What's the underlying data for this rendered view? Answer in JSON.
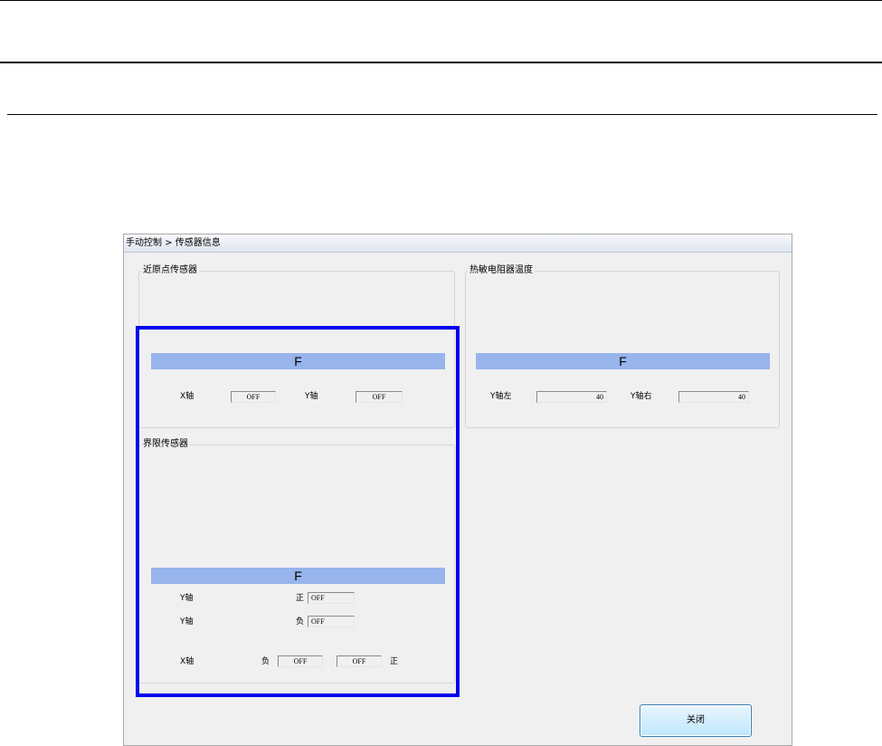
{
  "title": "手动控制 > 传感器信息",
  "near_origin": {
    "group_label": "近原点传感器",
    "bar_text": "F",
    "x_label": "X轴",
    "x_value": "OFF",
    "y_label": "Y轴",
    "y_value": "OFF"
  },
  "thermistor": {
    "group_label": "热敏电阻器温度",
    "bar_text": "F",
    "left_label": "Y轴左",
    "left_value": "40",
    "right_label": "Y轴右",
    "right_value": "40"
  },
  "limit": {
    "group_label": "界限传感器",
    "bar_text": "F",
    "row1_axis": "Y轴",
    "row1_dir": "正",
    "row1_value": "OFF",
    "row2_axis": "Y轴",
    "row2_dir": "负",
    "row2_value": "OFF",
    "row3_axis": "X轴",
    "row3_neg": "负",
    "row3_neg_value": "OFF",
    "row3_pos_value": "OFF",
    "row3_pos": "正"
  },
  "close_label": "关闭",
  "colors": {
    "header_bar": "#98b4ec",
    "highlight": "#0000f0"
  }
}
